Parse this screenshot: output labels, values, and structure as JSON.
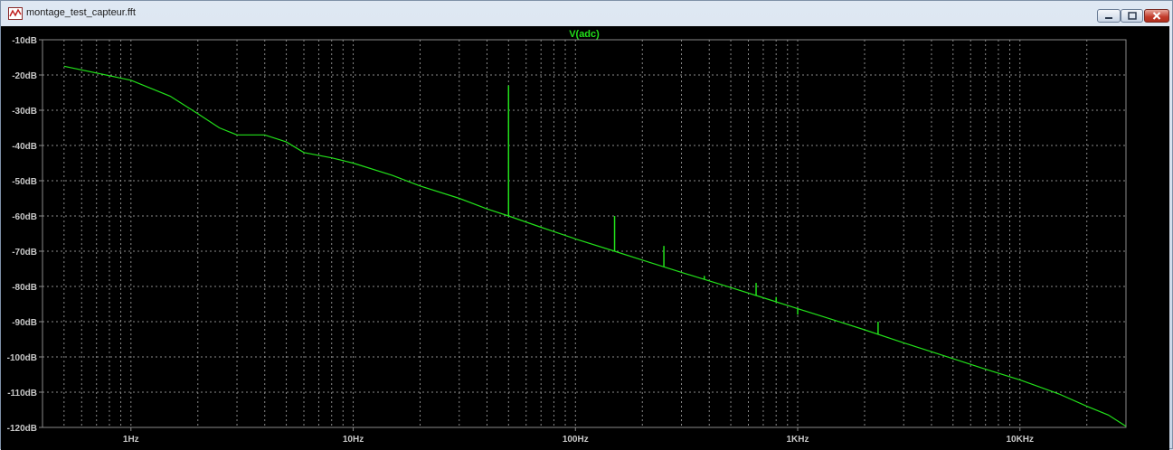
{
  "window": {
    "title": "montage_test_capteur.fft",
    "app_icon": "waveform-viewer-icon",
    "controls": [
      "minimize-icon",
      "maximize-icon",
      "close-icon"
    ]
  },
  "colors": {
    "plot_background": "#000000",
    "trace": "#22e01a",
    "grid": "#8a8a8a",
    "axis_text": "#c8c8c8",
    "close_button": "#c23a2a"
  },
  "chart_data": {
    "type": "line",
    "title": "V(adc)",
    "x_scale": "log",
    "xlim": [
      0.4,
      30000
    ],
    "ylim": [
      -120,
      -10
    ],
    "grid": true,
    "x_ticks": [
      {
        "value": 1,
        "label": "1Hz"
      },
      {
        "value": 10,
        "label": "10Hz"
      },
      {
        "value": 100,
        "label": "100Hz"
      },
      {
        "value": 1000,
        "label": "1KHz"
      },
      {
        "value": 10000,
        "label": "10KHz"
      }
    ],
    "y_ticks": [
      {
        "value": -10,
        "label": "-10dB"
      },
      {
        "value": -20,
        "label": "-20dB"
      },
      {
        "value": -30,
        "label": "-30dB"
      },
      {
        "value": -40,
        "label": "-40dB"
      },
      {
        "value": -50,
        "label": "-50dB"
      },
      {
        "value": -60,
        "label": "-60dB"
      },
      {
        "value": -70,
        "label": "-70dB"
      },
      {
        "value": -80,
        "label": "-80dB"
      },
      {
        "value": -90,
        "label": "-90dB"
      },
      {
        "value": -100,
        "label": "-100dB"
      },
      {
        "value": -110,
        "label": "-110dB"
      },
      {
        "value": -120,
        "label": "-120dB"
      }
    ],
    "series": [
      {
        "name": "V(adc)",
        "x": [
          0.5,
          1,
          1.5,
          2,
          2.5,
          3,
          4,
          5,
          6,
          8,
          10,
          15,
          20,
          30,
          40,
          50,
          70,
          100,
          150,
          200,
          300,
          500,
          700,
          1000,
          1500,
          2000,
          3000,
          5000,
          7000,
          10000,
          15000,
          20000,
          25000,
          30000
        ],
        "y": [
          -17.5,
          -21.5,
          -26,
          -31,
          -35,
          -37,
          -37,
          -39,
          -42,
          -43.5,
          -45,
          -48.5,
          -51.5,
          -55,
          -58,
          -60,
          -63.2,
          -66.5,
          -70,
          -72.5,
          -76,
          -80.3,
          -83.2,
          -86.3,
          -89.8,
          -92.3,
          -96,
          -100.5,
          -103.5,
          -106.5,
          -110.5,
          -114,
          -116.5,
          -119.7
        ]
      }
    ],
    "spikes": [
      {
        "x": 50,
        "y": -23
      },
      {
        "x": 150,
        "y": -60
      },
      {
        "x": 250,
        "y": -68.5
      },
      {
        "x": 380,
        "y": -77
      },
      {
        "x": 650,
        "y": -79
      },
      {
        "x": 800,
        "y": -83
      },
      {
        "x": 1000,
        "y": -88
      },
      {
        "x": 2300,
        "y": -90
      }
    ]
  }
}
